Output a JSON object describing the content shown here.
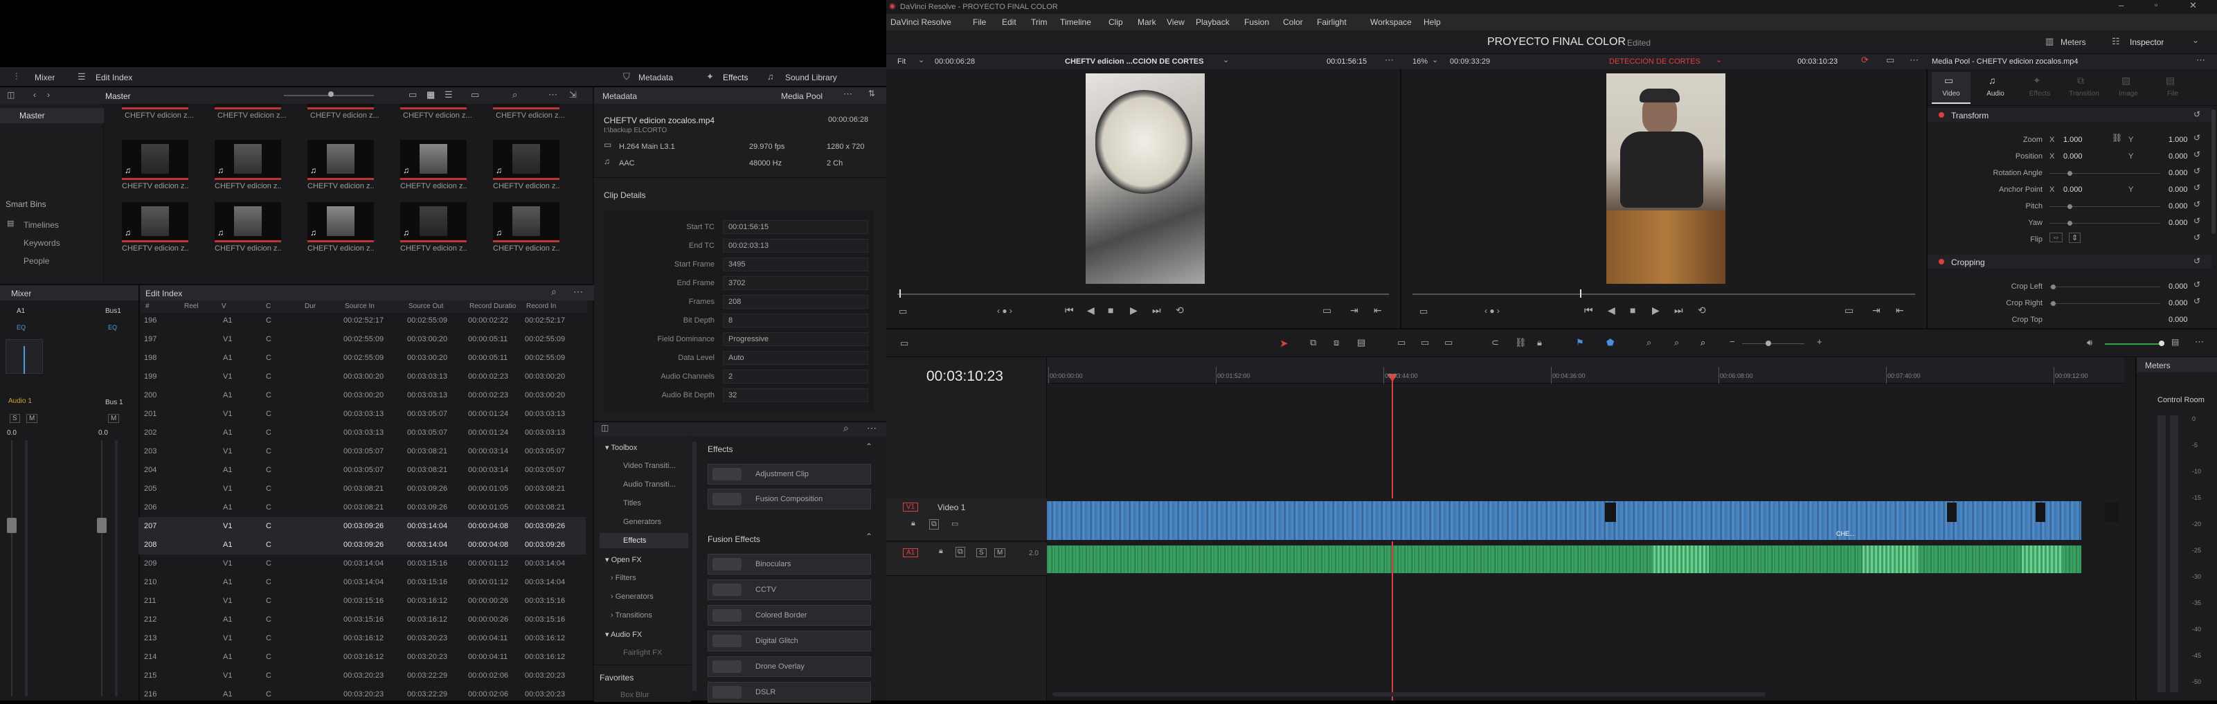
{
  "title_bar": {
    "app_title": "DaVinci Resolve - PROYECTO FINAL COLOR"
  },
  "menu": [
    "DaVinci Resolve",
    "File",
    "Edit",
    "Trim",
    "Timeline",
    "Clip",
    "Mark",
    "View",
    "Playback",
    "Fusion",
    "Color",
    "Fairlight",
    "Workspace",
    "Help"
  ],
  "project": {
    "name": "PROYECTO FINAL COLOR",
    "status": "Edited"
  },
  "top_right": {
    "meters": "Meters",
    "inspector": "Inspector"
  },
  "toolbar_left": {
    "mixer": "Mixer",
    "edit_index": "Edit Index",
    "metadata": "Metadata",
    "effects": "Effects",
    "sound_library": "Sound Library"
  },
  "media_pool": {
    "master_label": "Master",
    "bin_master": "Master",
    "smart_bins": "Smart Bins",
    "smart_items": [
      "Timelines",
      "Keywords",
      "People"
    ],
    "thumb_caption": "CHEFTV edicion z...",
    "top_caption": "CHEFTV edicion z..."
  },
  "metadata_panel": {
    "title": "Metadata",
    "media_pool_label": "Media Pool",
    "clip_name": "CHEFTV edicion zocalos.mp4",
    "duration": "00:00:06:28",
    "path": "I:\\backup ELCORTO",
    "codec": "H.264 Main L3.1",
    "fps": "29.970 fps",
    "resolution": "1280 x 720",
    "audio_codec": "AAC",
    "sample_rate": "48000 Hz",
    "channels": "2 Ch",
    "clip_details": "Clip Details",
    "details": [
      {
        "k": "Start TC",
        "v": "00:01:56:15"
      },
      {
        "k": "End TC",
        "v": "00:02:03:13"
      },
      {
        "k": "Start Frame",
        "v": "3495"
      },
      {
        "k": "End Frame",
        "v": "3702"
      },
      {
        "k": "Frames",
        "v": "208"
      },
      {
        "k": "Bit Depth",
        "v": "8"
      },
      {
        "k": "Field Dominance",
        "v": "Progressive"
      },
      {
        "k": "Data Level",
        "v": "Auto"
      },
      {
        "k": "Audio Channels",
        "v": "2"
      },
      {
        "k": "Audio Bit Depth",
        "v": "32"
      }
    ]
  },
  "mixer": {
    "title": "Mixer",
    "a1": "A1",
    "bus1": "Bus1",
    "bus1_label": "Bus 1",
    "audio1": "Audio 1",
    "eq": "EQ",
    "s": "S",
    "m": "M",
    "zero": "0.0"
  },
  "edit_index": {
    "title": "Edit Index",
    "columns": [
      "#",
      "Reel",
      "V",
      "C",
      "Dur",
      "Source In",
      "Source Out",
      "Record Duratio",
      "Record In"
    ],
    "rows": [
      [
        "196",
        "",
        "A1",
        "C",
        "",
        "00:02:52:17",
        "00:02:55:09",
        "00:00:02:22",
        "00:02:52:17"
      ],
      [
        "197",
        "",
        "V1",
        "C",
        "",
        "00:02:55:09",
        "00:03:00:20",
        "00:00:05:11",
        "00:02:55:09"
      ],
      [
        "198",
        "",
        "A1",
        "C",
        "",
        "00:02:55:09",
        "00:03:00:20",
        "00:00:05:11",
        "00:02:55:09"
      ],
      [
        "199",
        "",
        "V1",
        "C",
        "",
        "00:03:00:20",
        "00:03:03:13",
        "00:00:02:23",
        "00:03:00:20"
      ],
      [
        "200",
        "",
        "A1",
        "C",
        "",
        "00:03:00:20",
        "00:03:03:13",
        "00:00:02:23",
        "00:03:00:20"
      ],
      [
        "201",
        "",
        "V1",
        "C",
        "",
        "00:03:03:13",
        "00:03:05:07",
        "00:00:01:24",
        "00:03:03:13"
      ],
      [
        "202",
        "",
        "A1",
        "C",
        "",
        "00:03:03:13",
        "00:03:05:07",
        "00:00:01:24",
        "00:03:03:13"
      ],
      [
        "203",
        "",
        "V1",
        "C",
        "",
        "00:03:05:07",
        "00:03:08:21",
        "00:00:03:14",
        "00:03:05:07"
      ],
      [
        "204",
        "",
        "A1",
        "C",
        "",
        "00:03:05:07",
        "00:03:08:21",
        "00:00:03:14",
        "00:03:05:07"
      ],
      [
        "205",
        "",
        "V1",
        "C",
        "",
        "00:03:08:21",
        "00:03:09:26",
        "00:00:01:05",
        "00:03:08:21"
      ],
      [
        "206",
        "",
        "A1",
        "C",
        "",
        "00:03:08:21",
        "00:03:09:26",
        "00:00:01:05",
        "00:03:08:21"
      ],
      [
        "207",
        "",
        "V1",
        "C",
        "",
        "00:03:09:26",
        "00:03:14:04",
        "00:00:04:08",
        "00:03:09:26"
      ],
      [
        "208",
        "",
        "A1",
        "C",
        "",
        "00:03:09:26",
        "00:03:14:04",
        "00:00:04:08",
        "00:03:09:26"
      ],
      [
        "209",
        "",
        "V1",
        "C",
        "",
        "00:03:14:04",
        "00:03:15:16",
        "00:00:01:12",
        "00:03:14:04"
      ],
      [
        "210",
        "",
        "A1",
        "C",
        "",
        "00:03:14:04",
        "00:03:15:16",
        "00:00:01:12",
        "00:03:14:04"
      ],
      [
        "211",
        "",
        "V1",
        "C",
        "",
        "00:03:15:16",
        "00:03:16:12",
        "00:00:00:26",
        "00:03:15:16"
      ],
      [
        "212",
        "",
        "A1",
        "C",
        "",
        "00:03:15:16",
        "00:03:16:12",
        "00:00:00:26",
        "00:03:15:16"
      ],
      [
        "213",
        "",
        "V1",
        "C",
        "",
        "00:03:16:12",
        "00:03:20:23",
        "00:00:04:11",
        "00:03:16:12"
      ],
      [
        "214",
        "",
        "A1",
        "C",
        "",
        "00:03:16:12",
        "00:03:20:23",
        "00:00:04:11",
        "00:03:16:12"
      ],
      [
        "215",
        "",
        "V1",
        "C",
        "",
        "00:03:20:23",
        "00:03:22:29",
        "00:00:02:06",
        "00:03:20:23"
      ],
      [
        "216",
        "",
        "A1",
        "C",
        "",
        "00:03:20:23",
        "00:03:22:29",
        "00:00:02:06",
        "00:03:20:23"
      ]
    ]
  },
  "effects_tree": {
    "toolbox": "Toolbox",
    "items": [
      "Video Transiti...",
      "Audio Transiti...",
      "Titles",
      "Generators",
      "Effects"
    ],
    "open_fx": "Open FX",
    "open_fx_items": [
      "Filters",
      "Generators",
      "Transitions"
    ],
    "audio_fx": "Audio FX",
    "audio_fx_items": [
      "Fairlight FX"
    ],
    "favorites": "Favorites",
    "favorites_items": [
      "Box Blur"
    ]
  },
  "effects_list": {
    "effects_title": "Effects",
    "effects_items": [
      "Adjustment Clip",
      "Fusion Composition"
    ],
    "fusion_title": "Fusion Effects",
    "fusion_items": [
      "Binoculars",
      "CCTV",
      "Colored Border",
      "Digital Glitch",
      "Drone Overlay",
      "DSLR"
    ]
  },
  "source_viewer": {
    "zoom": "Fit",
    "tc_left": "00:00:06:28",
    "clip": "CHEFTV edicion ...CCIÓN DE CORTES",
    "tc_right": "00:01:56:15"
  },
  "timeline_viewer": {
    "zoom": "16%",
    "tc_left": "00:09:33:29",
    "timeline_name": "DETECCIÓN DE CORTES",
    "tc_right": "00:03:10:23"
  },
  "inspector": {
    "title": "Media Pool - CHEFTV edicion zocalos.mp4",
    "tabs": [
      "Video",
      "Audio",
      "Effects",
      "Transition",
      "Image",
      "File"
    ],
    "transform": "Transform",
    "zoom": {
      "label": "Zoom",
      "x": "1.000",
      "y": "1.000"
    },
    "position": {
      "label": "Position",
      "x": "0.000",
      "y": "0.000"
    },
    "rotation": {
      "label": "Rotation Angle",
      "v": "0.000"
    },
    "anchor": {
      "label": "Anchor Point",
      "x": "0.000",
      "y": "0.000"
    },
    "pitch": {
      "label": "Pitch",
      "v": "0.000"
    },
    "yaw": {
      "label": "Yaw",
      "v": "0.000"
    },
    "flip": "Flip",
    "cropping": "Cropping",
    "crop_left": {
      "label": "Crop Left",
      "v": "0.000"
    },
    "crop_right": {
      "label": "Crop Right",
      "v": "0.000"
    },
    "crop_top": {
      "label": "Crop Top",
      "v": "0.000"
    },
    "x": "X",
    "y": "Y"
  },
  "timeline": {
    "timecode": "00:03:10:23",
    "ruler": [
      "00:00:00:00",
      "00:01:52:00",
      "00:03:44:00",
      "00:04:36:00",
      "00:06:08:00",
      "00:07:40:00",
      "00:09:12:00"
    ],
    "v1": "V1",
    "video1": "Video 1",
    "a1": "A1",
    "a1_ch": "2.0",
    "clip_label": "CHE..."
  },
  "meters": {
    "title": "Meters",
    "control_room": "Control Room",
    "scale": [
      "0",
      "-5",
      "-10",
      "-15",
      "-20",
      "-25",
      "-30",
      "-35",
      "-40",
      "-45",
      "-50"
    ]
  }
}
